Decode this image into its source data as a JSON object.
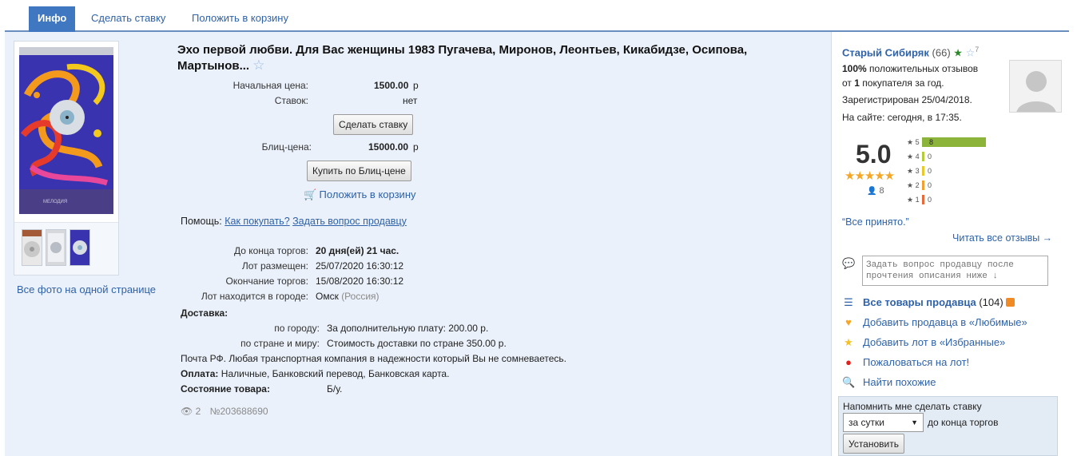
{
  "tabs": [
    {
      "label": "Инфо"
    },
    {
      "label": "Сделать ставку"
    },
    {
      "label": "Положить в корзину"
    }
  ],
  "gallery": {
    "all_photos_link": "Все фото на одной странице",
    "main_photo_label": "МЕЛОДИЯ"
  },
  "lot": {
    "title": "Эхо первой любви. Для Вас женщины 1983 Пугачева, Миронов, Леонтьев, Кикабидзе, Осипова, Мартынов...",
    "start_price_label": "Начальная цена:",
    "start_price_value": "1500.00",
    "currency": "р",
    "bids_label": "Ставок:",
    "bids_value": "нет",
    "bid_button": "Сделать ставку",
    "blitz_label": "Блиц-цена:",
    "blitz_value": "15000.00",
    "blitz_button": "Купить по Блиц-цене",
    "cart_link": "Положить в корзину",
    "help_label": "Помощь:",
    "help_link1": "Как покупать?",
    "help_link2": "Задать вопрос продавцу",
    "end_label": "До конца торгов:",
    "end_value": "20 дня(ей) 21 час.",
    "placed_label": "Лот размещен:",
    "placed_value": "25/07/2020 16:30:12",
    "finish_label": "Окончание торгов:",
    "finish_value": "15/08/2020 16:30:12",
    "city_label": "Лот находится в городе:",
    "city_value": "Омск",
    "country_value": "(Россия)",
    "delivery_label": "Доставка:",
    "city_delivery_label": "по городу:",
    "city_delivery_value": "За дополнительную плату: 200.00 р.",
    "country_delivery_label": "по стране и миру:",
    "country_delivery_value": "Стоимость доставки по стране 350.00 р.",
    "delivery_note": "Почта РФ. Любая транспортная компания в надежности который Вы не сомневаетесь.",
    "payment_label": "Оплата:",
    "payment_value": "Наличные, Банковский перевод, Банковская карта.",
    "condition_label": "Состояние товара:",
    "condition_value": "Б/у.",
    "views": "2",
    "lot_number": "№203688690"
  },
  "seller": {
    "name": "Старый Сибиряк",
    "count": "(66)",
    "star_count": "7",
    "positive_percent": "100%",
    "positive_text": "положительных отзывов",
    "from_text": "от",
    "buyers_count": "1",
    "buyers_text": "покупателя за год.",
    "registered": "Зарегистрирован 25/04/2018.",
    "online": "На сайте: сегодня, в 17:35.",
    "rating": "5.0",
    "rating_people": "8",
    "rating_bars": [
      {
        "label": "★ 5",
        "count": "8",
        "fraction": 1.0,
        "color": "#8cb43a"
      },
      {
        "label": "★ 4",
        "count": "0",
        "fraction": 0,
        "color": "#b5cc3a"
      },
      {
        "label": "★ 3",
        "count": "0",
        "fraction": 0,
        "color": "#e8c82c"
      },
      {
        "label": "★ 2",
        "count": "0",
        "fraction": 0,
        "color": "#f0a030"
      },
      {
        "label": "★ 1",
        "count": "0",
        "fraction": 0,
        "color": "#e56b3d"
      }
    ],
    "review_quote": "“Все принято.”",
    "read_all": "Читать все отзывы →",
    "ask_placeholder": "Задать вопрос продавцу после прочтения описания ниже ↓",
    "all_items": "Все товары продавца",
    "all_items_count": "(104)",
    "add_favorite_seller": "Добавить продавца в «Любимые»",
    "add_favorite_lot": "Добавить лот в «Избранные»",
    "complain": "Пожаловаться на лот!",
    "find_similar": "Найти похожие"
  },
  "reminder": {
    "title": "Напомнить мне сделать ставку",
    "select_value": "за сутки",
    "suffix": "до конца торгов",
    "button": "Установить"
  },
  "colors": {
    "accent": "#3f78c0",
    "link": "#2f62a8",
    "panel": "#eaf1fa"
  }
}
